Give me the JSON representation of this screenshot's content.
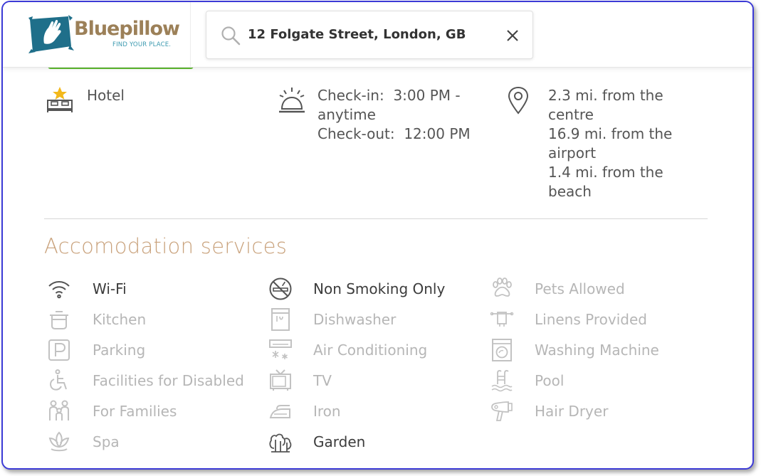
{
  "brand": {
    "name": "Bluepillow",
    "tagline": "FIND YOUR PLACE."
  },
  "search": {
    "query": "12 Folgate Street, London, GB"
  },
  "info": {
    "type": "Hotel",
    "checkin_label": "Check-in:",
    "checkin_value": "3:00 PM -",
    "checkin_value2": "anytime",
    "checkout_label": "Check-out:",
    "checkout_value": "12:00 PM",
    "distances": [
      "2.3 mi. from the",
      "centre",
      "16.9 mi. from the",
      "airport",
      "1.4 mi. from the",
      "beach"
    ]
  },
  "services_title": "Accomodation services",
  "services": [
    {
      "label": "Wi-Fi",
      "available": true,
      "icon": "wifi-icon"
    },
    {
      "label": "Kitchen",
      "available": false,
      "icon": "kitchen-pot-icon"
    },
    {
      "label": "Parking",
      "available": false,
      "icon": "parking-icon"
    },
    {
      "label": "Facilities for Disabled",
      "available": false,
      "icon": "wheelchair-icon"
    },
    {
      "label": "For Families",
      "available": false,
      "icon": "family-icon"
    },
    {
      "label": "Spa",
      "available": false,
      "icon": "lotus-icon"
    },
    {
      "label": "Non Smoking Only",
      "available": true,
      "icon": "no-smoking-icon"
    },
    {
      "label": "Dishwasher",
      "available": false,
      "icon": "dishwasher-icon"
    },
    {
      "label": "Air Conditioning",
      "available": false,
      "icon": "air-conditioner-icon"
    },
    {
      "label": "TV",
      "available": false,
      "icon": "tv-icon"
    },
    {
      "label": "Iron",
      "available": false,
      "icon": "iron-icon"
    },
    {
      "label": "Garden",
      "available": true,
      "icon": "trees-icon"
    },
    {
      "label": "Pets Allowed",
      "available": false,
      "icon": "paw-icon"
    },
    {
      "label": "Linens Provided",
      "available": false,
      "icon": "linens-icon"
    },
    {
      "label": "Washing Machine",
      "available": false,
      "icon": "washing-machine-icon"
    },
    {
      "label": "Pool",
      "available": false,
      "icon": "pool-ladder-icon"
    },
    {
      "label": "Hair Dryer",
      "available": false,
      "icon": "hair-dryer-icon"
    }
  ],
  "colors": {
    "accent_green": "#5dbb2f",
    "section_title": "#c9a27c",
    "frame_border": "#3c3ad6",
    "available_text": "#3c3c3c",
    "unavailable_text": "#b6b6b6"
  }
}
